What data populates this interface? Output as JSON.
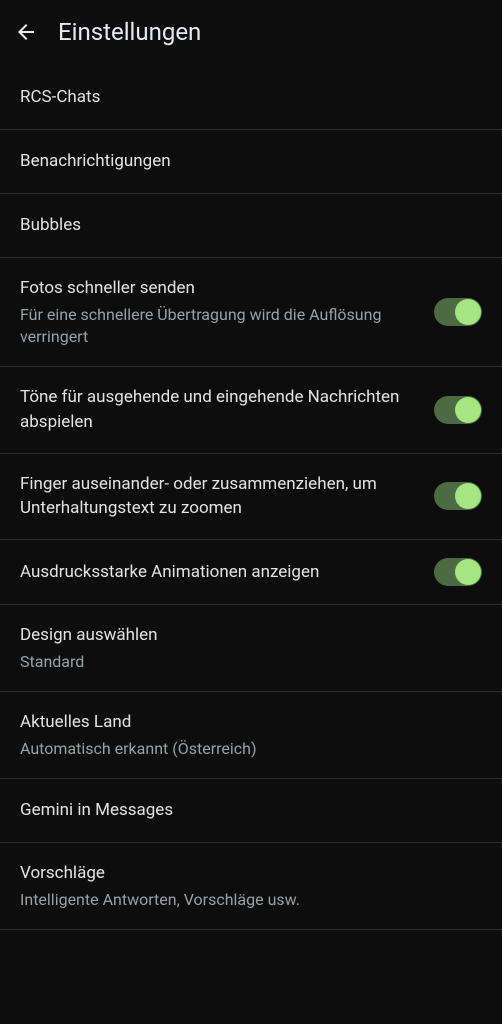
{
  "header": {
    "title": "Einstellungen"
  },
  "items": [
    {
      "title": "RCS-Chats",
      "subtitle": null,
      "toggle": null
    },
    {
      "title": "Benachrichtigungen",
      "subtitle": null,
      "toggle": null
    },
    {
      "title": "Bubbles",
      "subtitle": null,
      "toggle": null
    },
    {
      "title": "Fotos schneller senden",
      "subtitle": "Für eine schnellere Übertragung wird die Auflösung verringert",
      "toggle": true
    },
    {
      "title": "Töne für ausgehende und eingehende Nachrichten abspielen",
      "subtitle": null,
      "toggle": true
    },
    {
      "title": "Finger auseinander- oder zusammenziehen, um Unterhaltungstext zu zoomen",
      "subtitle": null,
      "toggle": true
    },
    {
      "title": "Ausdrucksstarke Animationen anzeigen",
      "subtitle": null,
      "toggle": true
    },
    {
      "title": "Design auswählen",
      "subtitle": "Standard",
      "toggle": null
    },
    {
      "title": "Aktuelles Land",
      "subtitle": "Automatisch erkannt (Österreich)",
      "toggle": null
    },
    {
      "title": "Gemini in Messages",
      "subtitle": null,
      "toggle": null
    },
    {
      "title": "Vorschläge",
      "subtitle": "Intelligente Antworten, Vorschläge usw.",
      "toggle": null
    }
  ]
}
